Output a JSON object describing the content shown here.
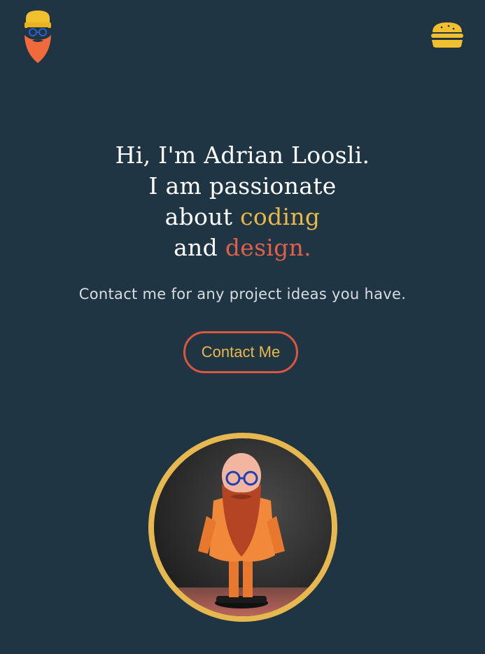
{
  "header": {
    "logo_icon": "bearded-man-beanie-logo-icon",
    "menu_icon": "burger-icon"
  },
  "hero": {
    "line1": "Hi, I'm Adrian Loosli.",
    "line2": "I am passionate",
    "line3_prefix": "about ",
    "line3_accent": "coding",
    "line4_prefix": "and ",
    "line4_accent": "design.",
    "subtitle": "Contact me for any project ideas you have.",
    "cta_label": "Contact Me"
  },
  "portrait": {
    "alt": "Figurine of a bald man with a long red beard and glasses",
    "icon": "figurine-portrait"
  },
  "colors": {
    "background": "#1f3544",
    "accent_yellow": "#e9b84a",
    "accent_red": "#e0604a",
    "cta_border": "#d9573f"
  }
}
